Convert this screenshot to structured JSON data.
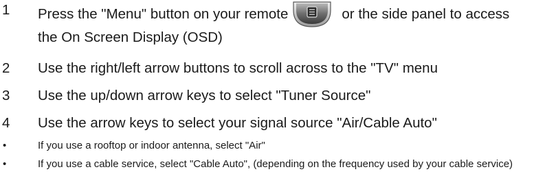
{
  "steps": [
    {
      "number": "1",
      "text_before_icon": "Press the \"Menu\" button on your remote",
      "text_after_icon": "or the side panel to access the On Screen Display (OSD)"
    },
    {
      "number": "2",
      "text": "Use the right/left arrow buttons to scroll across to the \"TV\" menu"
    },
    {
      "number": "3",
      "text": "Use the up/down arrow keys to select \"Tuner Source\""
    },
    {
      "number": "4",
      "text": "Use the arrow keys to select your signal source \"Air/Cable Auto\""
    }
  ],
  "bullets": [
    {
      "marker": "•",
      "text": "If you use a rooftop or indoor antenna, select \"Air\""
    },
    {
      "marker": "•",
      "text": "If you use a cable service, select \"Cable Auto\", (depending on the frequency used by your cable service)"
    }
  ],
  "icons": {
    "menu_button": "menu-button-icon"
  }
}
